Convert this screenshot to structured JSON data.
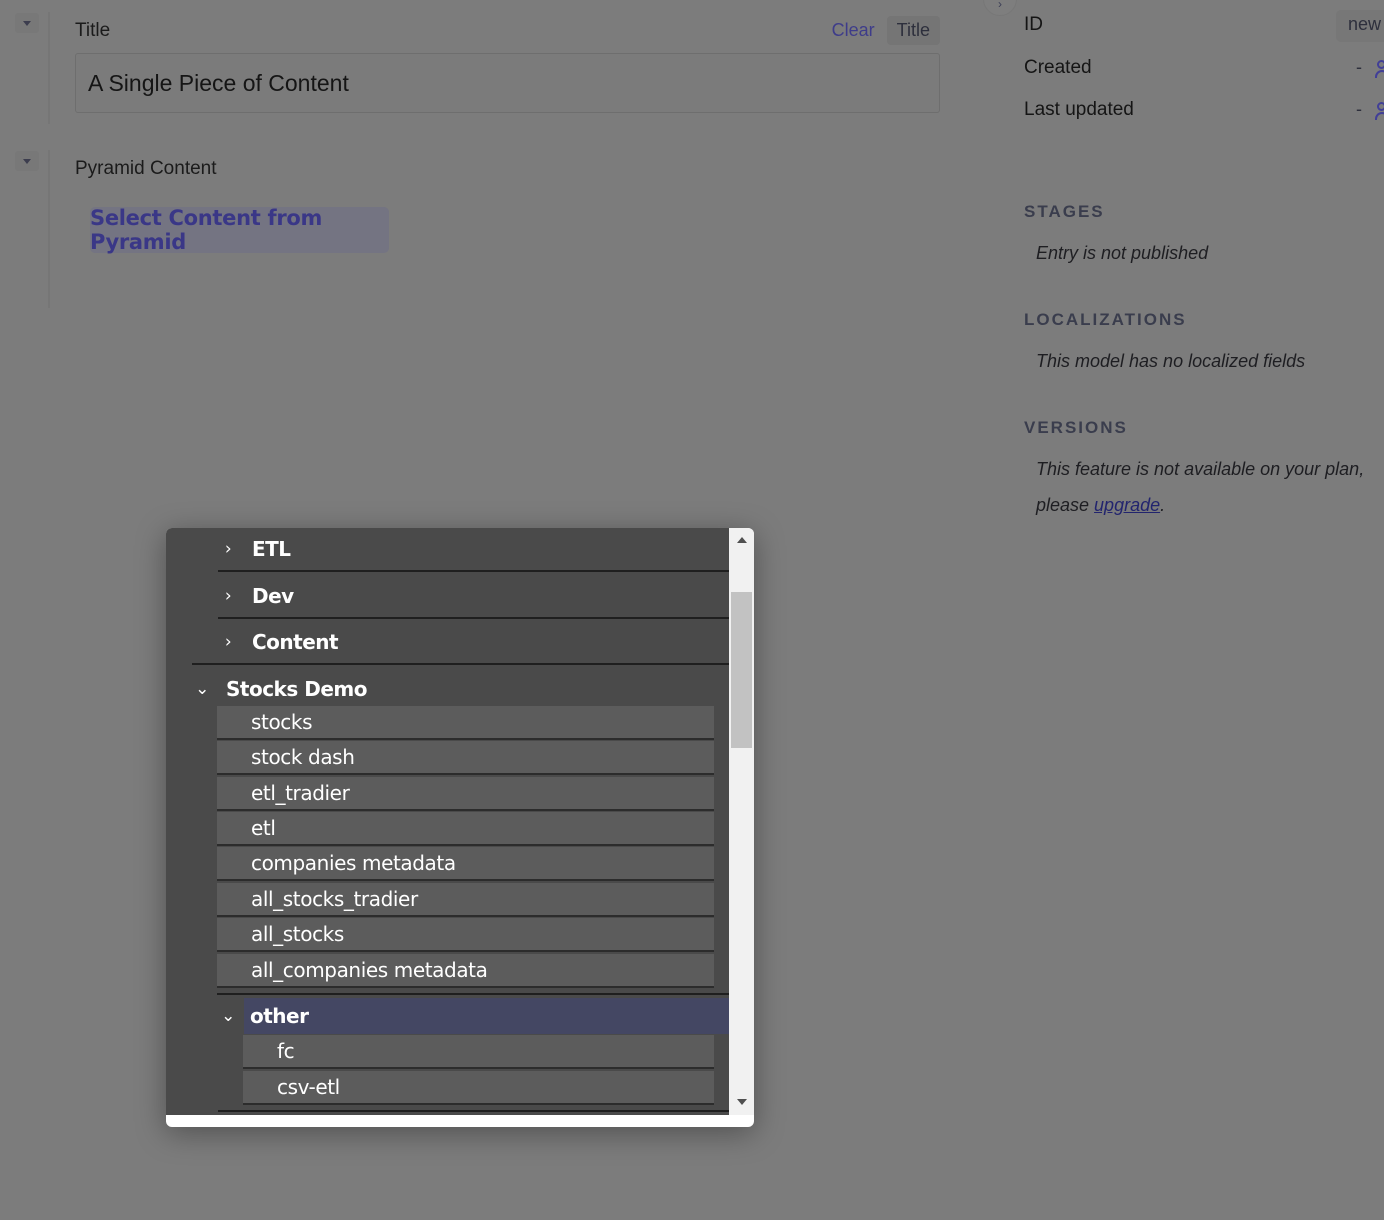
{
  "editor": {
    "title_field": {
      "label": "Title",
      "clear_label": "Clear",
      "badge_label": "Title",
      "value": "A Single Piece of Content"
    },
    "pyramid_field": {
      "label": "Pyramid Content",
      "button_label": "Select Content from Pyramid"
    }
  },
  "sidebar": {
    "meta": {
      "id_label": "ID",
      "id_value": "new",
      "created_label": "Created",
      "created_value": "-",
      "updated_label": "Last updated",
      "updated_value": "-"
    },
    "stages": {
      "heading": "STAGES",
      "text": "Entry is not published"
    },
    "localizations": {
      "heading": "LOCALIZATIONS",
      "text": "This model has no localized fields"
    },
    "versions": {
      "heading": "VERSIONS",
      "text_line1": "This feature is not available on your plan,",
      "text_prefix": "please ",
      "link_label": "upgrade",
      "text_suffix": "."
    }
  },
  "tree": {
    "folders_top": [
      {
        "label": "ETL",
        "expanded": false
      },
      {
        "label": "Dev",
        "expanded": false
      },
      {
        "label": "Content",
        "expanded": false
      }
    ],
    "stocks_demo": {
      "label": "Stocks Demo",
      "expanded": true,
      "items": [
        "stocks",
        "stock dash",
        "etl_tradier",
        "etl",
        "companies metadata",
        "all_stocks_tradier",
        "all_stocks",
        "all_companies metadata"
      ]
    },
    "other": {
      "label": "other",
      "expanded": true,
      "selected": true,
      "items": [
        "fc",
        "csv-etl"
      ]
    }
  },
  "colors": {
    "overlay": "#7c7c7c",
    "accent": "#3a3787",
    "tree_bg": "#4a4a4a",
    "tree_leaf_bg": "#5c5c5c",
    "tree_selected": "#444763"
  }
}
